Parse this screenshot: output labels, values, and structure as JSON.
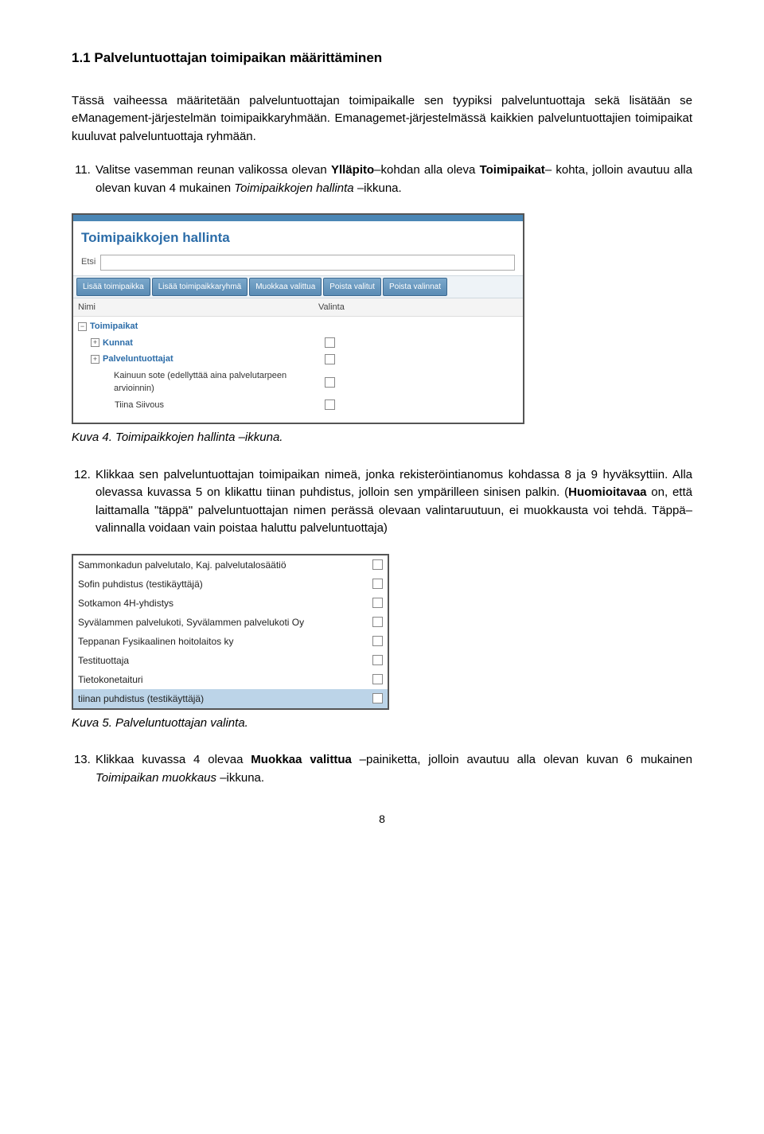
{
  "heading": "1.1 Palveluntuottajan toimipaikan määrittäminen",
  "intro": "Tässä vaiheessa määritetään palveluntuottajan toimipaikalle sen tyypiksi palveluntuottaja sekä lisätään se eManagement-järjestelmän toimipaikkaryhmään. Emanagemet-järjestelmässä kaikkien palveluntuottajien toimipaikat kuuluvat palveluntuottaja ryhmään.",
  "list11_prefix": "Valitse vasemman reunan valikossa olevan ",
  "list11_bold1": "Ylläpito",
  "list11_mid1": "–kohdan alla oleva ",
  "list11_bold2": "Toimipaikat",
  "list11_mid2": "– kohta, jolloin avautuu alla olevan kuvan 4 mukainen ",
  "list11_italic": "Toimipaikkojen hallinta",
  "list11_suffix": " –ikkuna.",
  "caption4_pre": "Kuva 4. ",
  "caption4_text": "Toimipaikkojen hallinta –ikkuna.",
  "list12_pre": "Klikkaa sen palveluntuottajan toimipaikan nimeä, jonka rekisteröintianomus kohdassa 8 ja 9 hyväksyttiin. Alla olevassa kuvassa 5 on klikattu tiinan puhdistus, jolloin sen ympärilleen sinisen palkin. (",
  "list12_bold": "Huomioitavaa",
  "list12_post": " on, että laittamalla \"täppä\" palveluntuottajan nimen perässä olevaan valintaruutuun, ei muokkausta voi tehdä. Täppä–valinnalla voidaan vain poistaa haluttu palveluntuottaja)",
  "caption5_pre": "Kuva 5. ",
  "caption5_text": "Palveluntuottajan valinta.",
  "list13_pre": "Klikkaa kuvassa 4 olevaa ",
  "list13_bold": "Muokkaa valittua",
  "list13_mid": " –painiketta, jolloin avautuu alla olevan kuvan 6 mukainen ",
  "list13_italic": "Toimipaikan muokkaus",
  "list13_suffix": " –ikkuna.",
  "pagenum": "8",
  "shot1": {
    "title": "Toimipaikkojen hallinta",
    "search_label": "Etsi",
    "buttons": [
      "Lisää toimipaikka",
      "Lisää toimipaikkaryhmä",
      "Muokkaa valittua",
      "Poista valitut",
      "Poista valinnat"
    ],
    "col1": "Nimi",
    "col2": "Valinta",
    "tree": [
      {
        "indent": 0,
        "toggle": "−",
        "label": "Toimipaikat",
        "bold": true,
        "checkbox": false
      },
      {
        "indent": 1,
        "toggle": "+",
        "label": "Kunnat",
        "bold": true,
        "checkbox": true
      },
      {
        "indent": 1,
        "toggle": "+",
        "label": "Palveluntuottajat",
        "bold": true,
        "checkbox": true
      },
      {
        "indent": 2,
        "toggle": "",
        "label": "Kainuun sote (edellyttää aina palvelutarpeen arvioinnin)",
        "bold": false,
        "black": true,
        "checkbox": true
      },
      {
        "indent": 2,
        "toggle": "",
        "label": "Tiina Siivous",
        "bold": false,
        "black": true,
        "checkbox": true
      }
    ]
  },
  "shot2": {
    "rows": [
      {
        "name": "Sammonkadun palvelutalo, Kaj. palvelutalosäätiö",
        "sel": false
      },
      {
        "name": "Sofin puhdistus (testikäyttäjä)",
        "sel": false
      },
      {
        "name": "Sotkamon 4H-yhdistys",
        "sel": false
      },
      {
        "name": "Syvälammen palvelukoti, Syvälammen palvelukoti Oy",
        "sel": false
      },
      {
        "name": "Teppanan Fysikaalinen hoitolaitos ky",
        "sel": false
      },
      {
        "name": "Testituottaja",
        "sel": false
      },
      {
        "name": "Tietokonetaituri",
        "sel": false
      },
      {
        "name": "tiinan puhdistus (testikäyttäjä)",
        "sel": true
      }
    ]
  }
}
